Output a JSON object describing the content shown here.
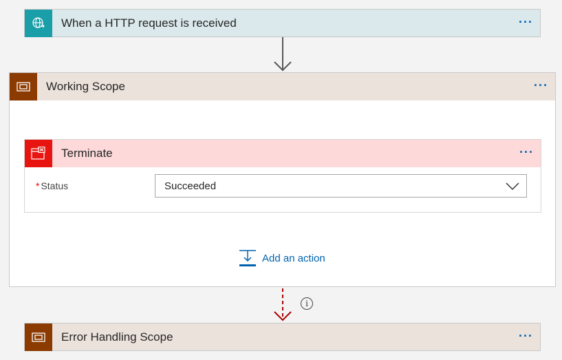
{
  "trigger": {
    "title": "When a HTTP request is received",
    "more": "···",
    "icon": "globe-request-icon",
    "color": "#1a9ea7"
  },
  "working_scope": {
    "title": "Working Scope",
    "more": "···",
    "icon": "scope-icon",
    "color": "#8b3a00",
    "terminate": {
      "title": "Terminate",
      "more": "···",
      "icon": "terminate-icon",
      "color": "#e8140f",
      "status_label": "Status",
      "required_mark": "*",
      "status_value": "Succeeded"
    },
    "add_action_label": "Add an action"
  },
  "info_symbol": "i",
  "error_scope": {
    "title": "Error Handling Scope",
    "more": "···",
    "icon": "scope-icon",
    "color": "#8b3a00"
  }
}
